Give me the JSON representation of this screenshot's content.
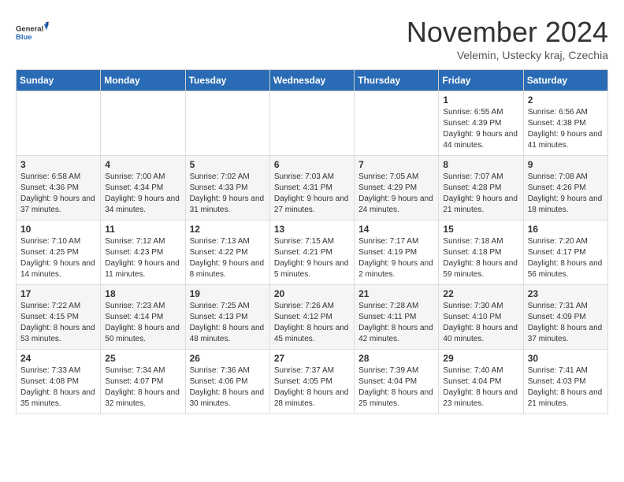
{
  "logo": {
    "line1": "General",
    "line2": "Blue"
  },
  "title": "November 2024",
  "subtitle": "Velemin, Ustecky kraj, Czechia",
  "headers": [
    "Sunday",
    "Monday",
    "Tuesday",
    "Wednesday",
    "Thursday",
    "Friday",
    "Saturday"
  ],
  "weeks": [
    [
      {
        "day": "",
        "info": ""
      },
      {
        "day": "",
        "info": ""
      },
      {
        "day": "",
        "info": ""
      },
      {
        "day": "",
        "info": ""
      },
      {
        "day": "",
        "info": ""
      },
      {
        "day": "1",
        "info": "Sunrise: 6:55 AM\nSunset: 4:39 PM\nDaylight: 9 hours\nand 44 minutes."
      },
      {
        "day": "2",
        "info": "Sunrise: 6:56 AM\nSunset: 4:38 PM\nDaylight: 9 hours\nand 41 minutes."
      }
    ],
    [
      {
        "day": "3",
        "info": "Sunrise: 6:58 AM\nSunset: 4:36 PM\nDaylight: 9 hours\nand 37 minutes."
      },
      {
        "day": "4",
        "info": "Sunrise: 7:00 AM\nSunset: 4:34 PM\nDaylight: 9 hours\nand 34 minutes."
      },
      {
        "day": "5",
        "info": "Sunrise: 7:02 AM\nSunset: 4:33 PM\nDaylight: 9 hours\nand 31 minutes."
      },
      {
        "day": "6",
        "info": "Sunrise: 7:03 AM\nSunset: 4:31 PM\nDaylight: 9 hours\nand 27 minutes."
      },
      {
        "day": "7",
        "info": "Sunrise: 7:05 AM\nSunset: 4:29 PM\nDaylight: 9 hours\nand 24 minutes."
      },
      {
        "day": "8",
        "info": "Sunrise: 7:07 AM\nSunset: 4:28 PM\nDaylight: 9 hours\nand 21 minutes."
      },
      {
        "day": "9",
        "info": "Sunrise: 7:08 AM\nSunset: 4:26 PM\nDaylight: 9 hours\nand 18 minutes."
      }
    ],
    [
      {
        "day": "10",
        "info": "Sunrise: 7:10 AM\nSunset: 4:25 PM\nDaylight: 9 hours\nand 14 minutes."
      },
      {
        "day": "11",
        "info": "Sunrise: 7:12 AM\nSunset: 4:23 PM\nDaylight: 9 hours\nand 11 minutes."
      },
      {
        "day": "12",
        "info": "Sunrise: 7:13 AM\nSunset: 4:22 PM\nDaylight: 9 hours\nand 8 minutes."
      },
      {
        "day": "13",
        "info": "Sunrise: 7:15 AM\nSunset: 4:21 PM\nDaylight: 9 hours\nand 5 minutes."
      },
      {
        "day": "14",
        "info": "Sunrise: 7:17 AM\nSunset: 4:19 PM\nDaylight: 9 hours\nand 2 minutes."
      },
      {
        "day": "15",
        "info": "Sunrise: 7:18 AM\nSunset: 4:18 PM\nDaylight: 8 hours\nand 59 minutes."
      },
      {
        "day": "16",
        "info": "Sunrise: 7:20 AM\nSunset: 4:17 PM\nDaylight: 8 hours\nand 56 minutes."
      }
    ],
    [
      {
        "day": "17",
        "info": "Sunrise: 7:22 AM\nSunset: 4:15 PM\nDaylight: 8 hours\nand 53 minutes."
      },
      {
        "day": "18",
        "info": "Sunrise: 7:23 AM\nSunset: 4:14 PM\nDaylight: 8 hours\nand 50 minutes."
      },
      {
        "day": "19",
        "info": "Sunrise: 7:25 AM\nSunset: 4:13 PM\nDaylight: 8 hours\nand 48 minutes."
      },
      {
        "day": "20",
        "info": "Sunrise: 7:26 AM\nSunset: 4:12 PM\nDaylight: 8 hours\nand 45 minutes."
      },
      {
        "day": "21",
        "info": "Sunrise: 7:28 AM\nSunset: 4:11 PM\nDaylight: 8 hours\nand 42 minutes."
      },
      {
        "day": "22",
        "info": "Sunrise: 7:30 AM\nSunset: 4:10 PM\nDaylight: 8 hours\nand 40 minutes."
      },
      {
        "day": "23",
        "info": "Sunrise: 7:31 AM\nSunset: 4:09 PM\nDaylight: 8 hours\nand 37 minutes."
      }
    ],
    [
      {
        "day": "24",
        "info": "Sunrise: 7:33 AM\nSunset: 4:08 PM\nDaylight: 8 hours\nand 35 minutes."
      },
      {
        "day": "25",
        "info": "Sunrise: 7:34 AM\nSunset: 4:07 PM\nDaylight: 8 hours\nand 32 minutes."
      },
      {
        "day": "26",
        "info": "Sunrise: 7:36 AM\nSunset: 4:06 PM\nDaylight: 8 hours\nand 30 minutes."
      },
      {
        "day": "27",
        "info": "Sunrise: 7:37 AM\nSunset: 4:05 PM\nDaylight: 8 hours\nand 28 minutes."
      },
      {
        "day": "28",
        "info": "Sunrise: 7:39 AM\nSunset: 4:04 PM\nDaylight: 8 hours\nand 25 minutes."
      },
      {
        "day": "29",
        "info": "Sunrise: 7:40 AM\nSunset: 4:04 PM\nDaylight: 8 hours\nand 23 minutes."
      },
      {
        "day": "30",
        "info": "Sunrise: 7:41 AM\nSunset: 4:03 PM\nDaylight: 8 hours\nand 21 minutes."
      }
    ]
  ]
}
